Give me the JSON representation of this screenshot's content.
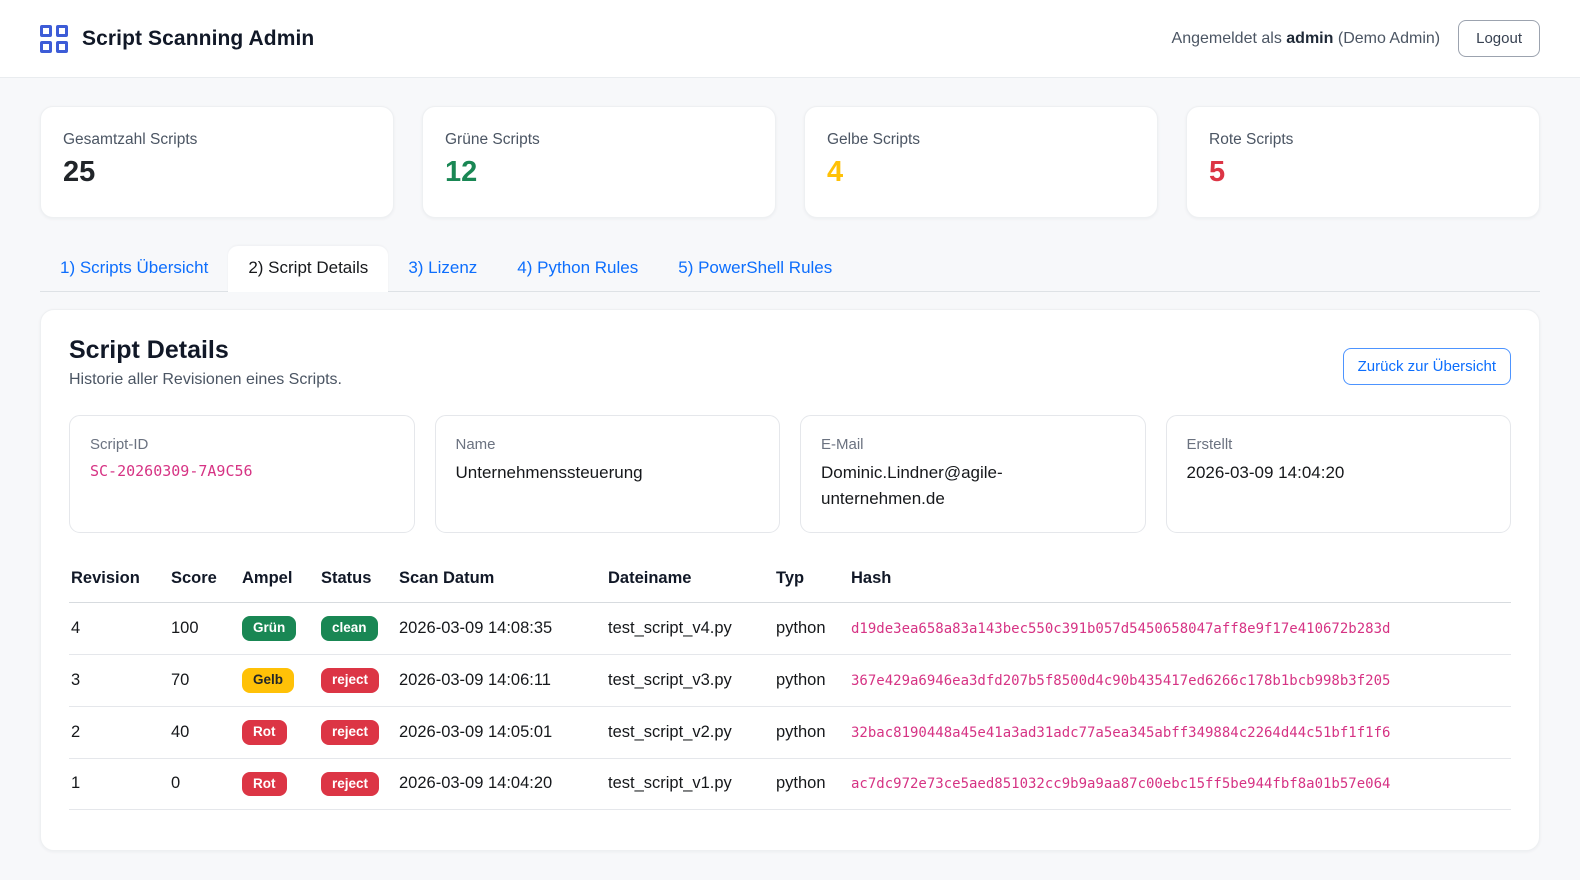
{
  "header": {
    "app_title": "Script Scanning Admin",
    "logged_in_prefix": "Angemeldet als",
    "logged_in_user": "admin",
    "logged_in_suffix": "(Demo Admin)",
    "logout_label": "Logout"
  },
  "stats": [
    {
      "label": "Gesamtzahl Scripts",
      "value": "25",
      "color": "#212529"
    },
    {
      "label": "Grüne Scripts",
      "value": "12",
      "color": "#198754"
    },
    {
      "label": "Gelbe Scripts",
      "value": "4",
      "color": "#ffc107"
    },
    {
      "label": "Rote Scripts",
      "value": "5",
      "color": "#dc3545"
    }
  ],
  "tabs": [
    {
      "label": "1) Scripts Übersicht",
      "active": false
    },
    {
      "label": "2) Script Details",
      "active": true
    },
    {
      "label": "3) Lizenz",
      "active": false
    },
    {
      "label": "4) Python Rules",
      "active": false
    },
    {
      "label": "5) PowerShell Rules",
      "active": false
    }
  ],
  "panel": {
    "title": "Script Details",
    "subtitle": "Historie aller Revisionen eines Scripts.",
    "back_button_label": "Zurück zur Übersicht",
    "info_cards": [
      {
        "label": "Script-ID",
        "value": "SC-20260309-7A9C56"
      },
      {
        "label": "Name",
        "value": "Unternehmenssteuerung"
      },
      {
        "label": "E-Mail",
        "value": "Dominic.Lindner@agile-unternehmen.de"
      },
      {
        "label": "Erstellt",
        "value": "2026-03-09 14:04:20"
      }
    ],
    "table": {
      "columns": [
        "Revision",
        "Score",
        "Ampel",
        "Status",
        "Scan Datum",
        "Dateiname",
        "Typ",
        "Hash"
      ],
      "rows": [
        {
          "revision": "4",
          "score": "100",
          "ampel": "Grün",
          "status": "clean",
          "scan_datum": "2026-03-09 14:08:35",
          "dateiname": "test_script_v4.py",
          "typ": "python",
          "hash": "d19de3ea658a83a143bec550c391b057d5450658047aff8e9f17e410672b283d"
        },
        {
          "revision": "3",
          "score": "70",
          "ampel": "Gelb",
          "status": "reject",
          "scan_datum": "2026-03-09 14:06:11",
          "dateiname": "test_script_v3.py",
          "typ": "python",
          "hash": "367e429a6946ea3dfd207b5f8500d4c90b435417ed6266c178b1bcb998b3f205"
        },
        {
          "revision": "2",
          "score": "40",
          "ampel": "Rot",
          "status": "reject",
          "scan_datum": "2026-03-09 14:05:01",
          "dateiname": "test_script_v2.py",
          "typ": "python",
          "hash": "32bac8190448a45e41a3ad31adc77a5ea345abff349884c2264d44c51bf1f1f6"
        },
        {
          "revision": "1",
          "score": "0",
          "ampel": "Rot",
          "status": "reject",
          "scan_datum": "2026-03-09 14:04:20",
          "dateiname": "test_script_v1.py",
          "typ": "python",
          "hash": "ac7dc972e73ce5aed851032cc9b9a9aa87c00ebc15ff5be944fbf8a01b57e064"
        }
      ]
    }
  },
  "colors": {
    "brand_blue": "#3d5cd7",
    "link_blue": "#0d6efd",
    "badge_green": "#198754",
    "badge_yellow": "#ffc107",
    "badge_red": "#dc3545",
    "code_pink": "#d63384",
    "page_background": "#f7f8fa"
  }
}
